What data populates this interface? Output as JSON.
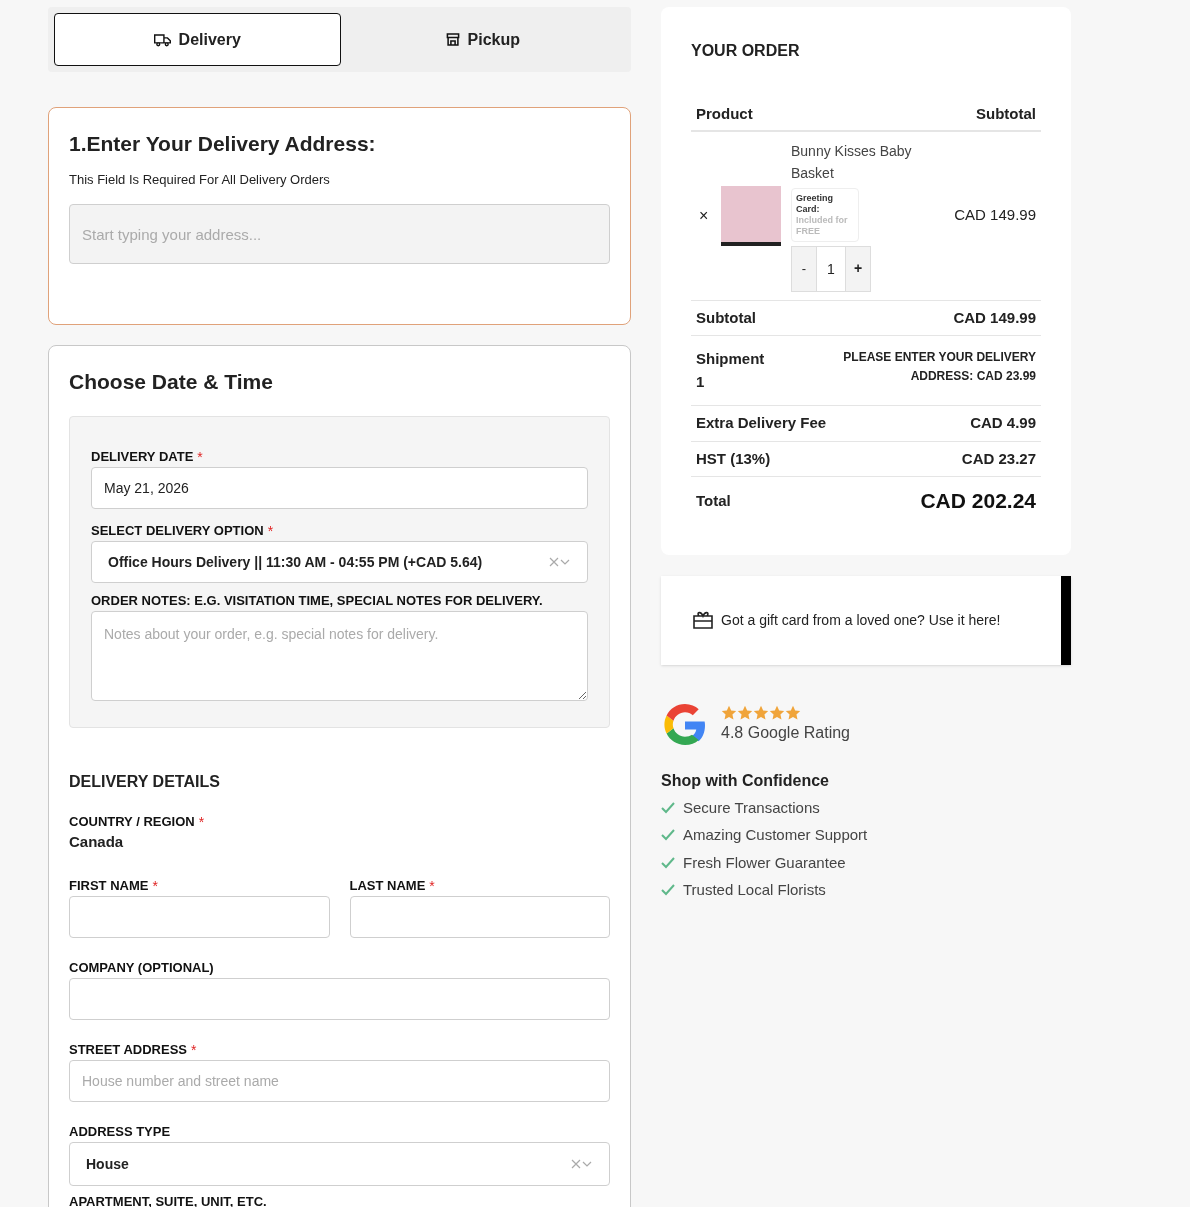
{
  "tabs": [
    {
      "label": "Delivery",
      "kind": "truck",
      "selected": true
    },
    {
      "label": "Pickup",
      "kind": "store",
      "selected": false
    }
  ],
  "address": {
    "title": "1.Enter Your Delivery Address:",
    "note": "This Field Is Required For All Delivery Orders",
    "placeholder": "Start typing your address..."
  },
  "datetime": {
    "title": "Choose Date & Time",
    "date_label": {
      "text": "DELIVERY DATE",
      "required_mark": "*"
    },
    "date_value": "May 21, 2026",
    "option_label": {
      "text": "SELECT DELIVERY OPTION",
      "required_mark": "*"
    },
    "option_value": "Office Hours Delivery || 11:30 AM - 04:55 PM (+CAD 5.64)",
    "notes_label": {
      "text": "ORDER NOTES: E.G. VISITATION TIME, SPECIAL NOTES FOR DELIVERY."
    },
    "notes_placeholder": "Notes about your order, e.g. special notes for delivery."
  },
  "details": {
    "title": "DELIVERY DETAILS",
    "country_label": {
      "text": "COUNTRY / REGION",
      "required_mark": "*"
    },
    "country_value": "Canada",
    "first_name_label": {
      "text": "FIRST NAME",
      "required_mark": "*"
    },
    "last_name_label": {
      "text": "LAST NAME",
      "required_mark": "*"
    },
    "company_label": {
      "text": "COMPANY (OPTIONAL)"
    },
    "street_label": {
      "text": "STREET ADDRESS",
      "required_mark": "*"
    },
    "street_placeholder": "House number and street name",
    "address_type_label": {
      "text": "ADDRESS TYPE"
    },
    "address_type_value": "House",
    "apartment_label": {
      "text": "APARTMENT, SUITE, UNIT, ETC."
    }
  },
  "order": {
    "title": "YOUR ORDER",
    "columns": [
      "Product",
      "Subtotal"
    ],
    "item": {
      "remove": "×",
      "name": "Bunny Kisses Baby Basket",
      "card_label": "Greeting Card:",
      "card_note": "Included for FREE",
      "quantity": "1",
      "minus": "-",
      "plus": "+",
      "price": "CAD 149.99"
    },
    "rows": [
      {
        "label": "Subtotal",
        "value": "CAD 149.99",
        "kind": "normal"
      },
      {
        "label": "Shipment 1",
        "value": "PLEASE ENTER YOUR DELIVERY ADDRESS: CAD 23.99",
        "kind": "note"
      },
      {
        "label": "Extra Delivery Fee",
        "value": "CAD 4.99",
        "kind": "normal"
      },
      {
        "label": "HST (13%)",
        "value": "CAD 23.27",
        "kind": "normal"
      },
      {
        "label": "Total",
        "value": "CAD 202.24",
        "kind": "total"
      }
    ]
  },
  "gift_card": {
    "text": "Got a gift card from a loved one? Use it here!"
  },
  "rating": {
    "stars": 5,
    "text": "4.8 Google Rating"
  },
  "confidence": {
    "title": "Shop with Confidence",
    "items": [
      "Secure Transactions",
      "Amazing Customer Support",
      "Fresh Flower Guarantee",
      "Trusted Local Florists"
    ]
  }
}
